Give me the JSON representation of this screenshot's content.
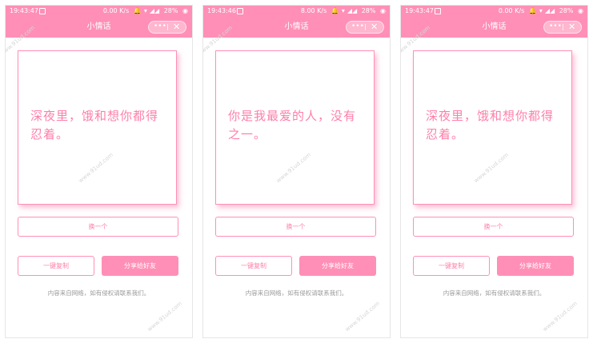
{
  "screens": [
    {
      "status": {
        "time": "19:43:47",
        "speed": "0.00 K/s",
        "battery": "28%"
      },
      "title": "小情话",
      "capsule": {
        "more": "•••",
        "close": "✕"
      },
      "quote": "深夜里，饿和想你都得忍着。",
      "watermark": "www.91ud.com",
      "buttons": {
        "swap": "换一个",
        "copy": "一键复制",
        "share": "分享给好友"
      },
      "notice": "内容来自网络，如有侵权请联系我们。"
    },
    {
      "status": {
        "time": "19:43:46",
        "speed": "8.00 K/s",
        "battery": "28%"
      },
      "title": "小情话",
      "capsule": {
        "more": "•••",
        "close": "✕"
      },
      "quote": "你是我最爱的人，没有之一。",
      "watermark": "www.91ud.com",
      "buttons": {
        "swap": "换一个",
        "copy": "一键复制",
        "share": "分享给好友"
      },
      "notice": "内容来自网络，如有侵权请联系我们。"
    },
    {
      "status": {
        "time": "19:43:47",
        "speed": "0.00 K/s",
        "battery": "28%"
      },
      "title": "小情话",
      "capsule": {
        "more": "•••",
        "close": "✕"
      },
      "quote": "深夜里，饿和想你都得忍着。",
      "watermark": "www.91ud.com",
      "buttons": {
        "swap": "换一个",
        "copy": "一键复制",
        "share": "分享给好友"
      },
      "notice": "内容来自网络，如有侵权请联系我们。"
    }
  ],
  "colors": {
    "accent": "#ff8fb6",
    "quote_text": "#ff7fa9",
    "notice_text": "#999999"
  }
}
